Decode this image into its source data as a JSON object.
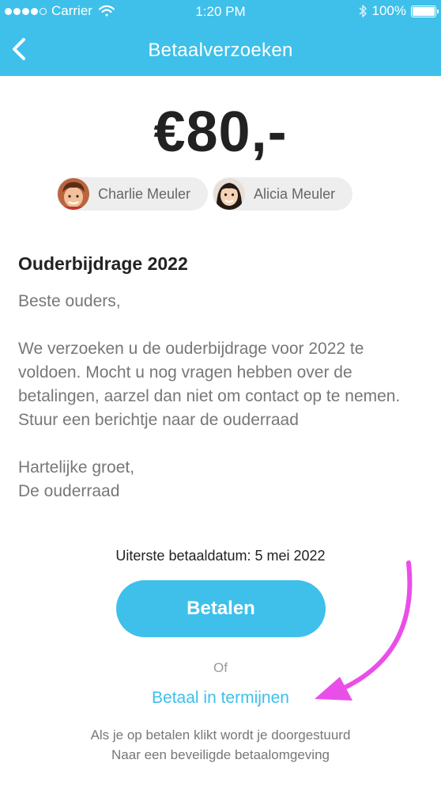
{
  "status_bar": {
    "carrier": "Carrier",
    "time": "1:20 PM",
    "battery": "100%"
  },
  "nav": {
    "title": "Betaalverzoeken"
  },
  "request": {
    "amount": "€80,-",
    "recipients": [
      {
        "name": "Charlie Meuler",
        "icon": "boy-avatar"
      },
      {
        "name": "Alicia Meuler",
        "icon": "girl-avatar"
      }
    ]
  },
  "message": {
    "title": "Ouderbijdrage 2022",
    "greeting": "Beste ouders,",
    "body": "We verzoeken u de ouderbijdrage voor 2022 te voldoen. Mocht u nog vragen hebben over de betalingen, aarzel dan niet om contact op te nemen. Stuur een berichtje naar de ouderraad",
    "closing_line1": "Hartelijke groet,",
    "closing_line2": "De ouderraad"
  },
  "payment": {
    "due_date": "Uiterste betaaldatum: 5 mei 2022",
    "pay_label": "Betalen",
    "or_label": "Of",
    "installments_label": "Betaal in termijnen",
    "note_line1": "Als je op betalen klikt wordt je doorgestuurd",
    "note_line2": "Naar een beveiligde betaalomgeving"
  },
  "colors": {
    "brand": "#3ec0ea",
    "annotation_arrow": "#ea4ee8"
  }
}
